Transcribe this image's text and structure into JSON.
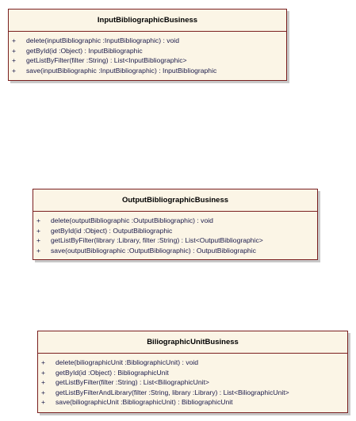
{
  "classes": [
    {
      "name": "InputBibliographicBusiness",
      "operations": [
        {
          "visibility": "+",
          "signature": "delete(inputBibliographic :InputBibliographic) : void"
        },
        {
          "visibility": "+",
          "signature": "getById(id :Object) : InputBibliographic"
        },
        {
          "visibility": "+",
          "signature": "getListByFilter(filter :String) : List<InputBibliographic>"
        },
        {
          "visibility": "+",
          "signature": "save(inputBibliographic :InputBibliographic) : InputBibliographic"
        }
      ]
    },
    {
      "name": "OutputBibliographicBusiness",
      "operations": [
        {
          "visibility": "+",
          "signature": "delete(outputBibliographic :OutputBibliographic) : void"
        },
        {
          "visibility": "+",
          "signature": "getById(id :Object) : OutputBibliographic"
        },
        {
          "visibility": "+",
          "signature": "getListByFilter(library :Library, filter :String) : List<OutputBibliographic>"
        },
        {
          "visibility": "+",
          "signature": "save(outputBibliographic :OutputBibliographic) : OutputBibliographic"
        }
      ]
    },
    {
      "name": "BiliographicUnitBusiness",
      "operations": [
        {
          "visibility": "+",
          "signature": "delete(biliographicUnit :BibliographicUnit) : void"
        },
        {
          "visibility": "+",
          "signature": "getById(id :Object) : BibliographicUnit"
        },
        {
          "visibility": "+",
          "signature": "getListByFilter(filter :String) : List<BiliographicUnit>"
        },
        {
          "visibility": "+",
          "signature": "getListByFilterAndLibrary(filter :String, library :Library) : List<BiliographicUnit>"
        },
        {
          "visibility": "+",
          "signature": "save(biliographicUnit :BibliographicUnit) : BibliographicUnit"
        }
      ]
    }
  ]
}
